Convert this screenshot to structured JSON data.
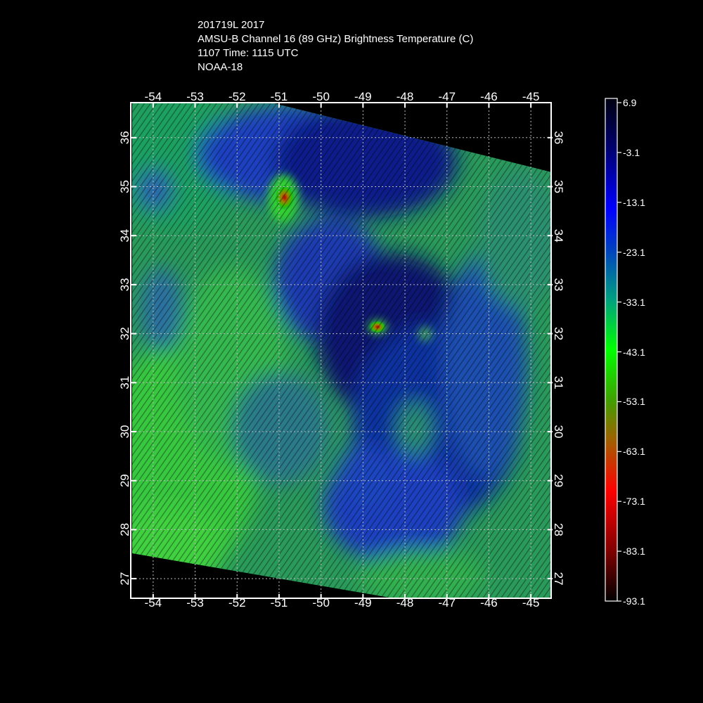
{
  "header": {
    "line1": "201719L 2017",
    "line2": "AMSU-B Channel 16 (89 GHz) Brightness Temperature (C)",
    "line3": "1107 Time: 1115 UTC",
    "line4": "NOAA-18"
  },
  "map": {
    "lon_labels": [
      "-54",
      "-53",
      "-52",
      "-51",
      "-50",
      "-49",
      "-48",
      "-47",
      "-46",
      "-45"
    ],
    "lat_labels": [
      "36",
      "35",
      "34",
      "33",
      "32",
      "31",
      "30",
      "29",
      "28",
      "27"
    ],
    "lon_values": [
      -54,
      -53,
      -52,
      -51,
      -50,
      -49,
      -48,
      -47,
      -46,
      -45
    ],
    "lat_values": [
      36,
      35,
      34,
      33,
      32,
      31,
      30,
      29,
      28,
      27
    ],
    "lon_range": [
      -54.5,
      -44.5
    ],
    "lat_range": [
      26.6,
      36.7
    ],
    "grid": true
  },
  "colorbar": {
    "labels": [
      "6.9",
      "-3.1",
      "-13.1",
      "-23.1",
      "-33.1",
      "-43.1",
      "-53.1",
      "-63.1",
      "-73.1",
      "-83.1",
      "-93.1"
    ],
    "colors": {
      "warm": "#000000",
      "navy": "#00008b",
      "blue": "#0000ff",
      "teal": "#0080a0",
      "green": "#00ff00",
      "olive": "#808000",
      "red": "#ff0000",
      "dark_red": "#300000"
    }
  }
}
